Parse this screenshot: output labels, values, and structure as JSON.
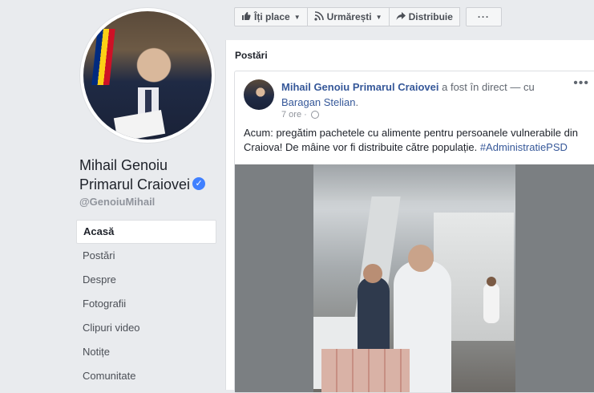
{
  "page": {
    "name_line1": "Mihail Genoiu",
    "name_line2": "Primarul Craiovei",
    "verified_glyph": "✓",
    "username": "@GenoiuMihail"
  },
  "nav": {
    "items": [
      {
        "label": "Acasă",
        "active": true
      },
      {
        "label": "Postări"
      },
      {
        "label": "Despre"
      },
      {
        "label": "Fotografii"
      },
      {
        "label": "Clipuri video"
      },
      {
        "label": "Notițe"
      },
      {
        "label": "Comunitate"
      }
    ]
  },
  "actions": {
    "like_label": "Îți place",
    "follow_label": "Urmărești",
    "share_label": "Distribuie",
    "more_label": "···",
    "like_icon": "thumbs-up-icon",
    "follow_icon": "rss-icon",
    "share_icon": "share-arrow-icon"
  },
  "posts": {
    "title": "Postări",
    "post": {
      "author": "Mihail Genoiu Primarul Craiovei",
      "action_text": " a fost în direct — cu ",
      "tagged": "Baragan Stelian",
      "period": ".",
      "time": "7 ore",
      "separator": "·",
      "menu": "•••",
      "text_main": "Acum: pregătim pachetele cu alimente pentru persoanele vulnerabile din Craiova! De mâine vor fi distribuite către populație. ",
      "hashtag": "#AdministratiePSD"
    }
  },
  "colors": {
    "link": "#365899",
    "verified": "#4080ff",
    "background": "#e9ebee"
  }
}
